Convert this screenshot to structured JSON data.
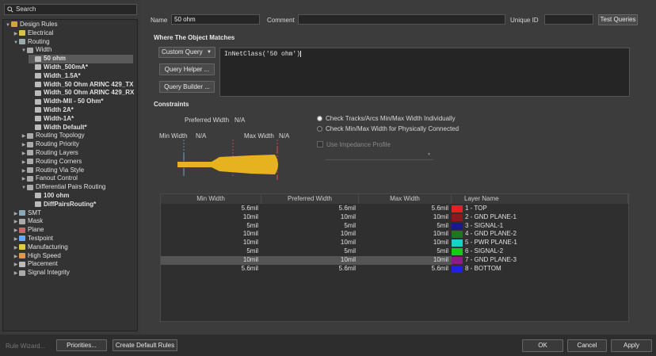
{
  "search": {
    "placeholder": "Search"
  },
  "tree": [
    {
      "label": "Design Rules",
      "level": 0,
      "arrow": "▼",
      "icon": "#d6a53a",
      "bold": false
    },
    {
      "label": "Electrical",
      "level": 1,
      "arrow": "▶",
      "icon": "#d8c24a"
    },
    {
      "label": "Routing",
      "level": 1,
      "arrow": "▼",
      "icon": "#9aa"
    },
    {
      "label": "Width",
      "level": 2,
      "arrow": "▼",
      "icon": "#aaa"
    },
    {
      "label": "50 ohm",
      "level": 3,
      "arrow": "",
      "icon": "#bbb",
      "bold": true,
      "selected": true
    },
    {
      "label": "Width_500mA*",
      "level": 3,
      "arrow": "",
      "icon": "#bbb",
      "bold": true
    },
    {
      "label": "Width_1.5A*",
      "level": 3,
      "arrow": "",
      "icon": "#bbb",
      "bold": true
    },
    {
      "label": "Width_50 Ohm ARINC 429_TX",
      "level": 3,
      "arrow": "",
      "icon": "#bbb",
      "bold": true
    },
    {
      "label": "Width_50 Ohm ARINC 429_RX",
      "level": 3,
      "arrow": "",
      "icon": "#bbb",
      "bold": true
    },
    {
      "label": "Width-MII - 50 Ohm*",
      "level": 3,
      "arrow": "",
      "icon": "#bbb",
      "bold": true
    },
    {
      "label": "Width 2A*",
      "level": 3,
      "arrow": "",
      "icon": "#bbb",
      "bold": true
    },
    {
      "label": "Width-1A*",
      "level": 3,
      "arrow": "",
      "icon": "#bbb",
      "bold": true
    },
    {
      "label": "Width Default*",
      "level": 3,
      "arrow": "",
      "icon": "#bbb",
      "bold": true
    },
    {
      "label": "Routing Topology",
      "level": 2,
      "arrow": "▶",
      "icon": "#aaa"
    },
    {
      "label": "Routing Priority",
      "level": 2,
      "arrow": "▶",
      "icon": "#aaa"
    },
    {
      "label": "Routing Layers",
      "level": 2,
      "arrow": "▶",
      "icon": "#aaa"
    },
    {
      "label": "Routing Corners",
      "level": 2,
      "arrow": "▶",
      "icon": "#aaa"
    },
    {
      "label": "Routing Via Style",
      "level": 2,
      "arrow": "▶",
      "icon": "#aaa"
    },
    {
      "label": "Fanout Control",
      "level": 2,
      "arrow": "▶",
      "icon": "#aaa"
    },
    {
      "label": "Differential Pairs Routing",
      "level": 2,
      "arrow": "▼",
      "icon": "#aaa"
    },
    {
      "label": "100 ohm",
      "level": 3,
      "arrow": "",
      "icon": "#bbb",
      "bold": true
    },
    {
      "label": "DiffPairsRouting*",
      "level": 3,
      "arrow": "",
      "icon": "#bbb",
      "bold": true
    },
    {
      "label": "SMT",
      "level": 1,
      "arrow": "▶",
      "icon": "#8ab"
    },
    {
      "label": "Mask",
      "level": 1,
      "arrow": "▶",
      "icon": "#aaa"
    },
    {
      "label": "Plane",
      "level": 1,
      "arrow": "▶",
      "icon": "#c66"
    },
    {
      "label": "Testpoint",
      "level": 1,
      "arrow": "▶",
      "icon": "#6af"
    },
    {
      "label": "Manufacturing",
      "level": 1,
      "arrow": "▶",
      "icon": "#dc4"
    },
    {
      "label": "High Speed",
      "level": 1,
      "arrow": "▶",
      "icon": "#d94"
    },
    {
      "label": "Placement",
      "level": 1,
      "arrow": "▶",
      "icon": "#bbb"
    },
    {
      "label": "Signal Integrity",
      "level": 1,
      "arrow": "▶",
      "icon": "#aaa"
    }
  ],
  "form": {
    "name_label": "Name",
    "name_value": "50 ohm",
    "comment_label": "Comment",
    "comment_value": "",
    "uid_label": "Unique ID",
    "uid_value": "",
    "test_queries": "Test Queries"
  },
  "match": {
    "header": "Where The Object Matches",
    "dropdown": "Custom Query",
    "query_helper": "Query Helper ...",
    "query_builder": "Query Builder ...",
    "query_text": "InNetClass('50 ohm')"
  },
  "constraints": {
    "header": "Constraints",
    "preferred_label": "Preferred Width",
    "preferred_value": "N/A",
    "min_label": "Min Width",
    "min_value": "N/A",
    "max_label": "Max Width",
    "max_value": "N/A",
    "radio1": "Check Tracks/Arcs Min/Max Width Individually",
    "radio2": "Check Min/Max Width for Physically Connected",
    "impedance": "Use Impedance Profile",
    "trace_color": "#e7b21f"
  },
  "table": {
    "headers": [
      "Min Width",
      "Preferred Width",
      "Max Width",
      "Layer Name"
    ],
    "rows": [
      {
        "min": "5.6mil",
        "pref": "5.6mil",
        "max": "5.6mil",
        "color": "#e52020",
        "layer": "1 - TOP"
      },
      {
        "min": "10mil",
        "pref": "10mil",
        "max": "10mil",
        "color": "#8b1a1a",
        "layer": "2 - GND PLANE-1"
      },
      {
        "min": "5mil",
        "pref": "5mil",
        "max": "5mil",
        "color": "#1a1a8b",
        "layer": "3 - SIGNAL-1"
      },
      {
        "min": "10mil",
        "pref": "10mil",
        "max": "10mil",
        "color": "#1a7a1a",
        "layer": "4 - GND PLANE-2"
      },
      {
        "min": "10mil",
        "pref": "10mil",
        "max": "10mil",
        "color": "#1ad3c8",
        "layer": "5 - PWR PLANE-1"
      },
      {
        "min": "5mil",
        "pref": "5mil",
        "max": "5mil",
        "color": "#1ac81a",
        "layer": "6 - SIGNAL-2"
      },
      {
        "min": "10mil",
        "pref": "10mil",
        "max": "10mil",
        "color": "#8b1a8b",
        "layer": "7 - GND PLANE-3",
        "selected": true
      },
      {
        "min": "5.6mil",
        "pref": "5.6mil",
        "max": "5.6mil",
        "color": "#2020e5",
        "layer": "8 - BOTTOM"
      }
    ]
  },
  "bottom": {
    "rule_wizard": "Rule Wizard...",
    "priorities": "Priorities...",
    "create_default": "Create Default Rules",
    "ok": "OK",
    "cancel": "Cancel",
    "apply": "Apply"
  }
}
